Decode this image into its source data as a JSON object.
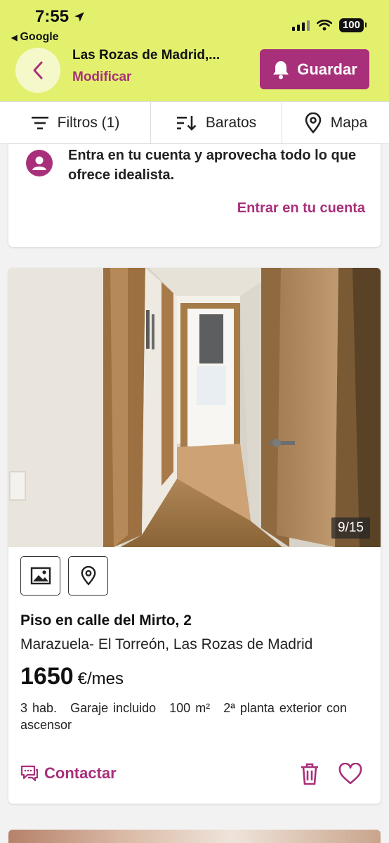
{
  "status_bar": {
    "time": "7:55",
    "back_app": "Google",
    "battery": "100"
  },
  "header": {
    "title": "Las Rozas de Madrid,...",
    "edit_label": "Modificar",
    "save_label": "Guardar"
  },
  "toolbar": {
    "filters_label": "Filtros (1)",
    "sort_label": "Baratos",
    "map_label": "Mapa"
  },
  "login_card": {
    "message": "Entra en tu cuenta y aprovecha todo lo que ofrece idealista.",
    "link": "Entrar en tu cuenta"
  },
  "listing": {
    "photo_counter": "9/15",
    "title": "Piso en calle del Mirto, 2",
    "location": "Marazuela- El Torreón, Las Rozas de Madrid",
    "price": "1650",
    "price_unit": "€/mes",
    "details": {
      "rooms": "3 hab.",
      "garage": "Garaje incluido",
      "size": "100 m²",
      "floor": "2ª planta exterior con ascensor"
    },
    "contact_label": "Contactar"
  },
  "colors": {
    "brand_lime": "#e2f06e",
    "brand_purple": "#a8307a"
  },
  "icons": [
    "chevron-left-icon",
    "bell-icon",
    "filter-icon",
    "sort-icon",
    "map-pin-icon",
    "user-icon",
    "image-icon",
    "location-icon",
    "chat-icon",
    "trash-icon",
    "heart-icon"
  ]
}
